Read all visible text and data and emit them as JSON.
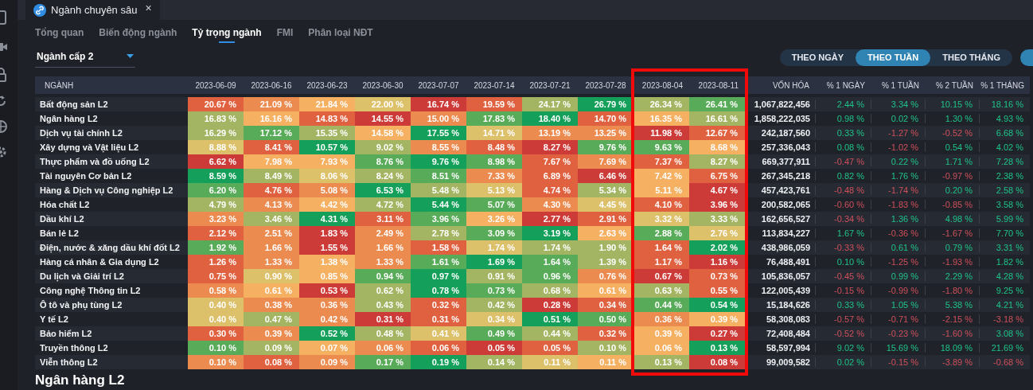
{
  "tab": {
    "title": "Ngành chuyên sâu",
    "close": "×"
  },
  "subtabs": [
    {
      "label": "Tổng quan",
      "selected": false
    },
    {
      "label": "Biến động ngành",
      "selected": false
    },
    {
      "label": "Tỷ trọng ngành",
      "selected": true
    },
    {
      "label": "FMI",
      "selected": false
    },
    {
      "label": "Phân loại NĐT",
      "selected": false
    }
  ],
  "dropdown": {
    "value": "Ngành cấp 2"
  },
  "periods": [
    {
      "label": "THEO NGÀY",
      "selected": false
    },
    {
      "label": "THEO TUẦN",
      "selected": true
    },
    {
      "label": "THEO THÁNG",
      "selected": false
    }
  ],
  "table": {
    "name_header": "NGÀNH",
    "cap_header": "VỐN HÓA",
    "change_headers": [
      "% 1 NGÀY",
      "% 1 TUẦN",
      "% 2 TUẦN",
      "% 1 THÁNG"
    ],
    "date_columns": [
      {
        "label": "2023-06-09"
      },
      {
        "label": "2023-06-16"
      },
      {
        "label": "2023-06-23"
      },
      {
        "label": "2023-06-30"
      },
      {
        "label": "2023-07-07"
      },
      {
        "label": "2023-07-14"
      },
      {
        "label": "2023-07-21"
      },
      {
        "label": "2023-07-28"
      },
      {
        "label": "2023-08-04"
      },
      {
        "label": "2023-08-11"
      }
    ],
    "highlight_frame": true,
    "rows": [
      {
        "name": "Bất động sản L2",
        "cells": [
          {
            "value": "20.67 %",
            "color": "#e0613f"
          },
          {
            "value": "21.09 %",
            "color": "#ec8b4f"
          },
          {
            "value": "21.84 %",
            "color": "#f5b062"
          },
          {
            "value": "22.00 %",
            "color": "#dcc06a"
          },
          {
            "value": "16.74 %",
            "color": "#cd3b38"
          },
          {
            "value": "19.59 %",
            "color": "#e0613f"
          },
          {
            "value": "24.17 %",
            "color": "#a3b562"
          },
          {
            "value": "26.79 %",
            "color": "#14a05a"
          },
          {
            "value": "26.34 %",
            "color": "#a3b562"
          },
          {
            "value": "26.41 %",
            "color": "#58ab58"
          }
        ],
        "cap": "1,067,822,456",
        "changes": [
          {
            "value": "2.44 %",
            "up": true
          },
          {
            "value": "3.34 %",
            "up": true
          },
          {
            "value": "10.15 %",
            "up": true
          },
          {
            "value": "18.16 %",
            "up": true
          }
        ]
      },
      {
        "name": "Ngân hàng L2",
        "cells": [
          {
            "value": "16.83 %",
            "color": "#a3b562"
          },
          {
            "value": "16.16 %",
            "color": "#f5b062"
          },
          {
            "value": "14.83 %",
            "color": "#e0613f"
          },
          {
            "value": "14.55 %",
            "color": "#cd3b38"
          },
          {
            "value": "15.00 %",
            "color": "#ec8b4f"
          },
          {
            "value": "17.83 %",
            "color": "#58ab58"
          },
          {
            "value": "18.40 %",
            "color": "#14a05a"
          },
          {
            "value": "14.70 %",
            "color": "#e0613f"
          },
          {
            "value": "16.35 %",
            "color": "#f5b062"
          },
          {
            "value": "16.61 %",
            "color": "#a3b562"
          }
        ],
        "cap": "1,858,222,035",
        "changes": [
          {
            "value": "0.98 %",
            "up": true
          },
          {
            "value": "0.02 %",
            "up": true
          },
          {
            "value": "1.30 %",
            "up": true
          },
          {
            "value": "4.93 %",
            "up": true
          }
        ]
      },
      {
        "name": "Dịch vụ tài chính L2",
        "cells": [
          {
            "value": "16.29 %",
            "color": "#a3b562"
          },
          {
            "value": "17.12 %",
            "color": "#58ab58"
          },
          {
            "value": "15.35 %",
            "color": "#a3b562"
          },
          {
            "value": "14.58 %",
            "color": "#f5b062"
          },
          {
            "value": "17.55 %",
            "color": "#14a05a"
          },
          {
            "value": "14.71 %",
            "color": "#dcc06a"
          },
          {
            "value": "13.19 %",
            "color": "#ec8b4f"
          },
          {
            "value": "13.25 %",
            "color": "#ec8b4f"
          },
          {
            "value": "11.98 %",
            "color": "#cd3b38"
          },
          {
            "value": "12.67 %",
            "color": "#e0613f"
          }
        ],
        "cap": "242,187,560",
        "changes": [
          {
            "value": "0.33 %",
            "up": true
          },
          {
            "value": "-1.27 %",
            "up": false
          },
          {
            "value": "-0.52 %",
            "up": false
          },
          {
            "value": "6.68 %",
            "up": true
          }
        ]
      },
      {
        "name": "Xây dựng và Vật liệu L2",
        "cells": [
          {
            "value": "8.88 %",
            "color": "#dcc06a"
          },
          {
            "value": "8.41 %",
            "color": "#e0613f"
          },
          {
            "value": "10.57 %",
            "color": "#14a05a"
          },
          {
            "value": "9.02 %",
            "color": "#a3b562"
          },
          {
            "value": "8.55 %",
            "color": "#ec8b4f"
          },
          {
            "value": "8.48 %",
            "color": "#e0613f"
          },
          {
            "value": "8.27 %",
            "color": "#cd3b38"
          },
          {
            "value": "9.76 %",
            "color": "#58ab58"
          },
          {
            "value": "9.63 %",
            "color": "#58ab58"
          },
          {
            "value": "8.68 %",
            "color": "#f5b062"
          }
        ],
        "cap": "257,336,043",
        "changes": [
          {
            "value": "0.08 %",
            "up": true
          },
          {
            "value": "-1.02 %",
            "up": false
          },
          {
            "value": "0.54 %",
            "up": true
          },
          {
            "value": "4.02 %",
            "up": true
          }
        ]
      },
      {
        "name": "Thực phẩm và đồ uống L2",
        "cells": [
          {
            "value": "6.62 %",
            "color": "#cd3b38"
          },
          {
            "value": "7.98 %",
            "color": "#f5b062"
          },
          {
            "value": "7.93 %",
            "color": "#f5b062"
          },
          {
            "value": "8.76 %",
            "color": "#58ab58"
          },
          {
            "value": "9.76 %",
            "color": "#14a05a"
          },
          {
            "value": "8.98 %",
            "color": "#58ab58"
          },
          {
            "value": "7.67 %",
            "color": "#e0613f"
          },
          {
            "value": "7.69 %",
            "color": "#ec8b4f"
          },
          {
            "value": "7.37 %",
            "color": "#e0613f"
          },
          {
            "value": "8.27 %",
            "color": "#a3b562"
          }
        ],
        "cap": "669,377,911",
        "changes": [
          {
            "value": "-0.47 %",
            "up": false
          },
          {
            "value": "0.22 %",
            "up": true
          },
          {
            "value": "1.71 %",
            "up": true
          },
          {
            "value": "7.28 %",
            "up": true
          }
        ]
      },
      {
        "name": "Tài nguyên Cơ bản L2",
        "cells": [
          {
            "value": "8.59 %",
            "color": "#14a05a"
          },
          {
            "value": "8.49 %",
            "color": "#a3b562"
          },
          {
            "value": "8.06 %",
            "color": "#dcc06a"
          },
          {
            "value": "8.24 %",
            "color": "#a3b562"
          },
          {
            "value": "8.51 %",
            "color": "#58ab58"
          },
          {
            "value": "7.33 %",
            "color": "#ec8b4f"
          },
          {
            "value": "6.89 %",
            "color": "#e0613f"
          },
          {
            "value": "6.46 %",
            "color": "#cd3b38"
          },
          {
            "value": "7.42 %",
            "color": "#f5b062"
          },
          {
            "value": "6.75 %",
            "color": "#e0613f"
          }
        ],
        "cap": "267,345,218",
        "changes": [
          {
            "value": "0.82 %",
            "up": true
          },
          {
            "value": "1.76 %",
            "up": true
          },
          {
            "value": "-0.97 %",
            "up": false
          },
          {
            "value": "2.38 %",
            "up": true
          }
        ]
      },
      {
        "name": "Hàng & Dịch vụ Công nghiệp L2",
        "cells": [
          {
            "value": "6.20 %",
            "color": "#58ab58"
          },
          {
            "value": "4.76 %",
            "color": "#e0613f"
          },
          {
            "value": "5.08 %",
            "color": "#ec8b4f"
          },
          {
            "value": "6.53 %",
            "color": "#14a05a"
          },
          {
            "value": "5.48 %",
            "color": "#a3b562"
          },
          {
            "value": "5.13 %",
            "color": "#dcc06a"
          },
          {
            "value": "4.74 %",
            "color": "#e0613f"
          },
          {
            "value": "5.34 %",
            "color": "#a3b562"
          },
          {
            "value": "5.11 %",
            "color": "#f5b062"
          },
          {
            "value": "4.67 %",
            "color": "#cd3b38"
          }
        ],
        "cap": "457,423,761",
        "changes": [
          {
            "value": "-0.48 %",
            "up": false
          },
          {
            "value": "-1.74 %",
            "up": false
          },
          {
            "value": "0.20 %",
            "up": true
          },
          {
            "value": "2.58 %",
            "up": true
          }
        ]
      },
      {
        "name": "Hóa chất L2",
        "cells": [
          {
            "value": "4.79 %",
            "color": "#a3b562"
          },
          {
            "value": "4.13 %",
            "color": "#ec8b4f"
          },
          {
            "value": "4.42 %",
            "color": "#f5b062"
          },
          {
            "value": "4.72 %",
            "color": "#a3b562"
          },
          {
            "value": "5.44 %",
            "color": "#14a05a"
          },
          {
            "value": "5.07 %",
            "color": "#58ab58"
          },
          {
            "value": "4.30 %",
            "color": "#ec8b4f"
          },
          {
            "value": "4.45 %",
            "color": "#dcc06a"
          },
          {
            "value": "4.10 %",
            "color": "#e0613f"
          },
          {
            "value": "3.96 %",
            "color": "#cd3b38"
          }
        ],
        "cap": "200,582,065",
        "changes": [
          {
            "value": "-0.60 %",
            "up": false
          },
          {
            "value": "-1.83 %",
            "up": false
          },
          {
            "value": "-0.85 %",
            "up": false
          },
          {
            "value": "3.58 %",
            "up": true
          }
        ]
      },
      {
        "name": "Dầu khí L2",
        "cells": [
          {
            "value": "3.23 %",
            "color": "#ec8b4f"
          },
          {
            "value": "3.46 %",
            "color": "#a3b562"
          },
          {
            "value": "4.31 %",
            "color": "#14a05a"
          },
          {
            "value": "3.11 %",
            "color": "#e0613f"
          },
          {
            "value": "3.96 %",
            "color": "#58ab58"
          },
          {
            "value": "3.26 %",
            "color": "#f5b062"
          },
          {
            "value": "2.77 %",
            "color": "#cd3b38"
          },
          {
            "value": "2.91 %",
            "color": "#e0613f"
          },
          {
            "value": "3.32 %",
            "color": "#dcc06a"
          },
          {
            "value": "3.33 %",
            "color": "#a3b562"
          }
        ],
        "cap": "162,656,527",
        "changes": [
          {
            "value": "-0.34 %",
            "up": false
          },
          {
            "value": "1.36 %",
            "up": true
          },
          {
            "value": "4.98 %",
            "up": true
          },
          {
            "value": "5.99 %",
            "up": true
          }
        ]
      },
      {
        "name": "Bán lẻ L2",
        "cells": [
          {
            "value": "2.12 %",
            "color": "#e0613f"
          },
          {
            "value": "2.51 %",
            "color": "#ec8b4f"
          },
          {
            "value": "1.83 %",
            "color": "#cd3b38"
          },
          {
            "value": "2.49 %",
            "color": "#ec8b4f"
          },
          {
            "value": "2.78 %",
            "color": "#a3b562"
          },
          {
            "value": "3.09 %",
            "color": "#58ab58"
          },
          {
            "value": "3.19 %",
            "color": "#14a05a"
          },
          {
            "value": "2.63 %",
            "color": "#f5b062"
          },
          {
            "value": "2.88 %",
            "color": "#58ab58"
          },
          {
            "value": "2.76 %",
            "color": "#dcc06a"
          }
        ],
        "cap": "113,834,227",
        "changes": [
          {
            "value": "1.67 %",
            "up": true
          },
          {
            "value": "-0.36 %",
            "up": false
          },
          {
            "value": "-1.67 %",
            "up": false
          },
          {
            "value": "7.70 %",
            "up": true
          }
        ]
      },
      {
        "name": "Điện, nước & xăng dầu khí đốt L2",
        "cells": [
          {
            "value": "1.92 %",
            "color": "#58ab58"
          },
          {
            "value": "1.66 %",
            "color": "#ec8b4f"
          },
          {
            "value": "1.55 %",
            "color": "#cd3b38"
          },
          {
            "value": "1.66 %",
            "color": "#ec8b4f"
          },
          {
            "value": "1.58 %",
            "color": "#e0613f"
          },
          {
            "value": "1.74 %",
            "color": "#dcc06a"
          },
          {
            "value": "1.74 %",
            "color": "#a3b562"
          },
          {
            "value": "1.90 %",
            "color": "#a3b562"
          },
          {
            "value": "1.64 %",
            "color": "#e0613f"
          },
          {
            "value": "2.02 %",
            "color": "#14a05a"
          }
        ],
        "cap": "438,986,059",
        "changes": [
          {
            "value": "-0.33 %",
            "up": false
          },
          {
            "value": "0.61 %",
            "up": true
          },
          {
            "value": "0.79 %",
            "up": true
          },
          {
            "value": "3.31 %",
            "up": true
          }
        ]
      },
      {
        "name": "Hàng cá nhân & Gia dụng L2",
        "cells": [
          {
            "value": "1.26 %",
            "color": "#e0613f"
          },
          {
            "value": "1.33 %",
            "color": "#ec8b4f"
          },
          {
            "value": "1.38 %",
            "color": "#f5b062"
          },
          {
            "value": "1.33 %",
            "color": "#ec8b4f"
          },
          {
            "value": "1.61 %",
            "color": "#58ab58"
          },
          {
            "value": "1.69 %",
            "color": "#14a05a"
          },
          {
            "value": "1.64 %",
            "color": "#58ab58"
          },
          {
            "value": "1.39 %",
            "color": "#a3b562"
          },
          {
            "value": "1.17 %",
            "color": "#e0613f"
          },
          {
            "value": "1.16 %",
            "color": "#cd3b38"
          }
        ],
        "cap": "76,488,491",
        "changes": [
          {
            "value": "0.10 %",
            "up": true
          },
          {
            "value": "-1.25 %",
            "up": false
          },
          {
            "value": "-1.93 %",
            "up": false
          },
          {
            "value": "1.82 %",
            "up": true
          }
        ]
      },
      {
        "name": "Du lịch và Giải trí L2",
        "cells": [
          {
            "value": "0.75 %",
            "color": "#e0613f"
          },
          {
            "value": "0.90 %",
            "color": "#dcc06a"
          },
          {
            "value": "0.85 %",
            "color": "#f5b062"
          },
          {
            "value": "0.94 %",
            "color": "#58ab58"
          },
          {
            "value": "0.97 %",
            "color": "#14a05a"
          },
          {
            "value": "0.91 %",
            "color": "#a3b562"
          },
          {
            "value": "0.96 %",
            "color": "#58ab58"
          },
          {
            "value": "0.76 %",
            "color": "#ec8b4f"
          },
          {
            "value": "0.67 %",
            "color": "#cd3b38"
          },
          {
            "value": "0.73 %",
            "color": "#e0613f"
          }
        ],
        "cap": "105,836,057",
        "changes": [
          {
            "value": "-0.45 %",
            "up": false
          },
          {
            "value": "0.99 %",
            "up": true
          },
          {
            "value": "2.29 %",
            "up": true
          },
          {
            "value": "4.28 %",
            "up": true
          }
        ]
      },
      {
        "name": "Công nghệ Thông tin L2",
        "cells": [
          {
            "value": "0.58 %",
            "color": "#ec8b4f"
          },
          {
            "value": "0.61 %",
            "color": "#f5b062"
          },
          {
            "value": "0.53 %",
            "color": "#cd3b38"
          },
          {
            "value": "0.62 %",
            "color": "#a3b562"
          },
          {
            "value": "0.78 %",
            "color": "#14a05a"
          },
          {
            "value": "0.73 %",
            "color": "#58ab58"
          },
          {
            "value": "0.68 %",
            "color": "#a3b562"
          },
          {
            "value": "0.61 %",
            "color": "#f5b062"
          },
          {
            "value": "0.63 %",
            "color": "#a3b562"
          },
          {
            "value": "0.55 %",
            "color": "#e0613f"
          }
        ],
        "cap": "122,005,439",
        "changes": [
          {
            "value": "-0.15 %",
            "up": false
          },
          {
            "value": "-0.99 %",
            "up": false
          },
          {
            "value": "-1.80 %",
            "up": false
          },
          {
            "value": "9.25 %",
            "up": true
          }
        ]
      },
      {
        "name": "Ô tô và phụ tùng L2",
        "cells": [
          {
            "value": "0.40 %",
            "color": "#dcc06a"
          },
          {
            "value": "0.38 %",
            "color": "#ec8b4f"
          },
          {
            "value": "0.36 %",
            "color": "#ec8b4f"
          },
          {
            "value": "0.43 %",
            "color": "#a3b562"
          },
          {
            "value": "0.32 %",
            "color": "#e0613f"
          },
          {
            "value": "0.42 %",
            "color": "#a3b562"
          },
          {
            "value": "0.28 %",
            "color": "#cd3b38"
          },
          {
            "value": "0.34 %",
            "color": "#e0613f"
          },
          {
            "value": "0.44 %",
            "color": "#58ab58"
          },
          {
            "value": "0.54 %",
            "color": "#14a05a"
          }
        ],
        "cap": "15,184,626",
        "changes": [
          {
            "value": "0.33 %",
            "up": true
          },
          {
            "value": "1.05 %",
            "up": true
          },
          {
            "value": "5.38 %",
            "up": true
          },
          {
            "value": "4.21 %",
            "up": true
          }
        ]
      },
      {
        "name": "Y tế L2",
        "cells": [
          {
            "value": "0.40 %",
            "color": "#dcc06a"
          },
          {
            "value": "0.47 %",
            "color": "#a3b562"
          },
          {
            "value": "0.42 %",
            "color": "#ec8b4f"
          },
          {
            "value": "0.31 %",
            "color": "#cd3b38"
          },
          {
            "value": "0.31 %",
            "color": "#e0613f"
          },
          {
            "value": "0.34 %",
            "color": "#dcc06a"
          },
          {
            "value": "0.51 %",
            "color": "#14a05a"
          },
          {
            "value": "0.50 %",
            "color": "#58ab58"
          },
          {
            "value": "0.36 %",
            "color": "#ec8b4f"
          },
          {
            "value": "0.39 %",
            "color": "#f5b062"
          }
        ],
        "cap": "58,308,083",
        "changes": [
          {
            "value": "-0.57 %",
            "up": false
          },
          {
            "value": "-0.71 %",
            "up": false
          },
          {
            "value": "-2.15 %",
            "up": false
          },
          {
            "value": "-3.18 %",
            "up": false
          }
        ]
      },
      {
        "name": "Bảo hiểm L2",
        "cells": [
          {
            "value": "0.30 %",
            "color": "#e0613f"
          },
          {
            "value": "0.39 %",
            "color": "#ec8b4f"
          },
          {
            "value": "0.52 %",
            "color": "#14a05a"
          },
          {
            "value": "0.48 %",
            "color": "#a3b562"
          },
          {
            "value": "0.41 %",
            "color": "#dcc06a"
          },
          {
            "value": "0.49 %",
            "color": "#58ab58"
          },
          {
            "value": "0.44 %",
            "color": "#a3b562"
          },
          {
            "value": "0.32 %",
            "color": "#e0613f"
          },
          {
            "value": "0.39 %",
            "color": "#f5b062"
          },
          {
            "value": "0.27 %",
            "color": "#cd3b38"
          }
        ],
        "cap": "72,408,484",
        "changes": [
          {
            "value": "-0.52 %",
            "up": false
          },
          {
            "value": "-0.23 %",
            "up": false
          },
          {
            "value": "-1.60 %",
            "up": false
          },
          {
            "value": "3.08 %",
            "up": true
          }
        ]
      },
      {
        "name": "Truyền thông L2",
        "cells": [
          {
            "value": "0.10 %",
            "color": "#58ab58"
          },
          {
            "value": "0.09 %",
            "color": "#a3b562"
          },
          {
            "value": "0.07 %",
            "color": "#f5b062"
          },
          {
            "value": "0.06 %",
            "color": "#ec8b4f"
          },
          {
            "value": "0.06 %",
            "color": "#e0613f"
          },
          {
            "value": "0.05 %",
            "color": "#cd3b38"
          },
          {
            "value": "0.05 %",
            "color": "#e0613f"
          },
          {
            "value": "0.10 %",
            "color": "#a3b562"
          },
          {
            "value": "0.06 %",
            "color": "#f5b062"
          },
          {
            "value": "0.13 %",
            "color": "#14a05a"
          }
        ],
        "cap": "58,597,994",
        "changes": [
          {
            "value": "9.02 %",
            "up": true
          },
          {
            "value": "15.69 %",
            "up": true
          },
          {
            "value": "18.09 %",
            "up": true
          },
          {
            "value": "21.69 %",
            "up": true
          }
        ]
      },
      {
        "name": "Viễn thông L2",
        "cells": [
          {
            "value": "0.10 %",
            "color": "#ec8b4f"
          },
          {
            "value": "0.08 %",
            "color": "#e0613f"
          },
          {
            "value": "0.09 %",
            "color": "#ec8b4f"
          },
          {
            "value": "0.17 %",
            "color": "#58ab58"
          },
          {
            "value": "0.19 %",
            "color": "#14a05a"
          },
          {
            "value": "0.14 %",
            "color": "#a3b562"
          },
          {
            "value": "0.11 %",
            "color": "#dcc06a"
          },
          {
            "value": "0.11 %",
            "color": "#f5b062"
          },
          {
            "value": "0.13 %",
            "color": "#a3b562"
          },
          {
            "value": "0.08 %",
            "color": "#cd3b38"
          }
        ],
        "cap": "99,009,582",
        "changes": [
          {
            "value": "0.02 %",
            "up": true
          },
          {
            "value": "-0.15 %",
            "up": false
          },
          {
            "value": "-3.89 %",
            "up": false
          },
          {
            "value": "-0.68 %",
            "up": false
          }
        ]
      }
    ]
  },
  "next_section": {
    "title": "Ngân hàng L2"
  }
}
